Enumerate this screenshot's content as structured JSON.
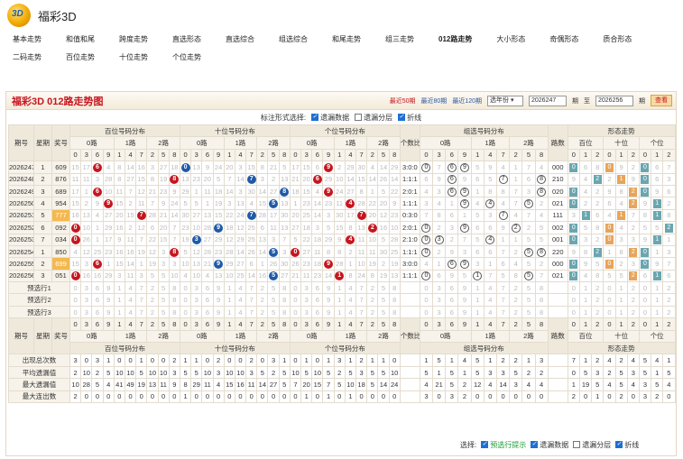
{
  "app": {
    "title": "福彩3D",
    "logo_text": "3D"
  },
  "nav": [
    "基本走势",
    "和值和尾",
    "跨度走势",
    "直选形态",
    "直选综合",
    "组选综合",
    "和尾走势",
    "组三走势",
    "012路走势",
    "大小形态",
    "奇偶形态",
    "质合形态",
    "二码走势",
    "百位走势",
    "十位走势",
    "个位走势"
  ],
  "nav_active": "012路走势",
  "panel": {
    "title": "福彩3D 012路走势图",
    "recent50": "最近50期",
    "recent80": "最近80期",
    "recent120": "最近120期",
    "select": "选年份",
    "from": "2026247",
    "period1": "期",
    "to_label": "至",
    "to": "2026256",
    "period2": "期",
    "query": "查看"
  },
  "options": {
    "label": "标注形式选择:",
    "o1": "遗漏数据",
    "o2": "遗漏分层",
    "o3": "折线"
  },
  "headers": {
    "issue": "期号",
    "weekday": "星期",
    "prize": "奖号",
    "bai": "百位号码分布",
    "shi": "十位号码分布",
    "ge": "个位号码分布",
    "geshu": "个数比",
    "zu": "组选号码分布",
    "lushu": "路数",
    "xingtai": "形态走势",
    "r0": "0路",
    "r1": "1路",
    "r2": "2路",
    "digits": [
      "0",
      "3",
      "6",
      "9",
      "1",
      "4",
      "7",
      "2",
      "5",
      "8"
    ],
    "baiw": "百位",
    "shiw": "十位",
    "gew": "个位",
    "xt": [
      "0",
      "1",
      "2"
    ]
  },
  "rows": [
    {
      "issue": "2026247",
      "w": "1",
      "p": "609",
      "ratio": "3:0:0",
      "lu": "000"
    },
    {
      "issue": "2026248",
      "w": "2",
      "p": "876",
      "ratio": "1:1:1",
      "lu": "210"
    },
    {
      "issue": "2026249",
      "w": "3",
      "p": "689",
      "ratio": "2:0:1",
      "lu": "020"
    },
    {
      "issue": "2026250",
      "w": "4",
      "p": "954",
      "ratio": "1:1:1",
      "lu": "021"
    },
    {
      "issue": "2026251",
      "w": "5",
      "p": "777",
      "ratio": "0:3:0",
      "lu": "111"
    },
    {
      "issue": "2026252",
      "w": "6",
      "p": "092",
      "ratio": "2:0:1",
      "lu": "002"
    },
    {
      "issue": "2026253",
      "w": "7",
      "p": "034",
      "ratio": "2:1:0",
      "lu": "001"
    },
    {
      "issue": "2026254",
      "w": "1",
      "p": "850",
      "ratio": "1:1:1",
      "lu": "220"
    },
    {
      "issue": "2026255",
      "w": "2",
      "p": "699",
      "ratio": "3:0:0",
      "lu": "000"
    },
    {
      "issue": "2026256",
      "w": "3",
      "p": "051",
      "ratio": "1:1:1",
      "lu": "021"
    }
  ],
  "predict": [
    "预选行1",
    "预选行2",
    "预选行3"
  ],
  "stats": [
    {
      "label": "出现总次数",
      "bai": "3 0 3 1 0 0 1 0 0 2",
      "shi": "1 1 0 2 0 0 2 0 3 1",
      "ge": "0 1 0 1 3 1 2 1 1 0",
      "zu": "1 5 1 4 5 1 2 2 1 3 3",
      "xt": "7 1 2 4 2 4 5 4 1"
    },
    {
      "label": "平均遗漏值",
      "bai": "2 10 2 5 10 10 5 10 10 3",
      "shi": "5 5 10 3 10 10 3 5 2 5",
      "ge": "10 5 10 5 2 5 3 5 5 10",
      "zu": "5 1 5 1 5 3 3 5 2 2",
      "xt": "0 5 3 2 5 3 5 1 5"
    },
    {
      "label": "最大遗漏值",
      "bai": "10 28 5 4 41 49 19 13 11 9",
      "shi": "8 29 11 4 15 16 11 14 27 5",
      "ge": "7 20 15 7 5 10 18 5 14 24",
      "zu": "4 21 5 2 12 4 14 3 4 4",
      "xt": "1 19 5 4 5 4 3 5 4"
    },
    {
      "label": "最大连出数",
      "bai": "2 0 0 0 0 0 0 0 0 0",
      "shi": "1 0 0 0 0 0 0 0 0 0",
      "ge": "0 1 0 1 0 1 0 0 0 0",
      "zu": "3 0 3 2 0 0 0 0 0 0",
      "xt": "2 0 1 0 2 0 3 2 0"
    }
  ],
  "bottom": {
    "label": "选择:",
    "o1": "预选行提示",
    "o2": "遗漏数据",
    "o3": "遗漏分层",
    "o4": "折线"
  }
}
